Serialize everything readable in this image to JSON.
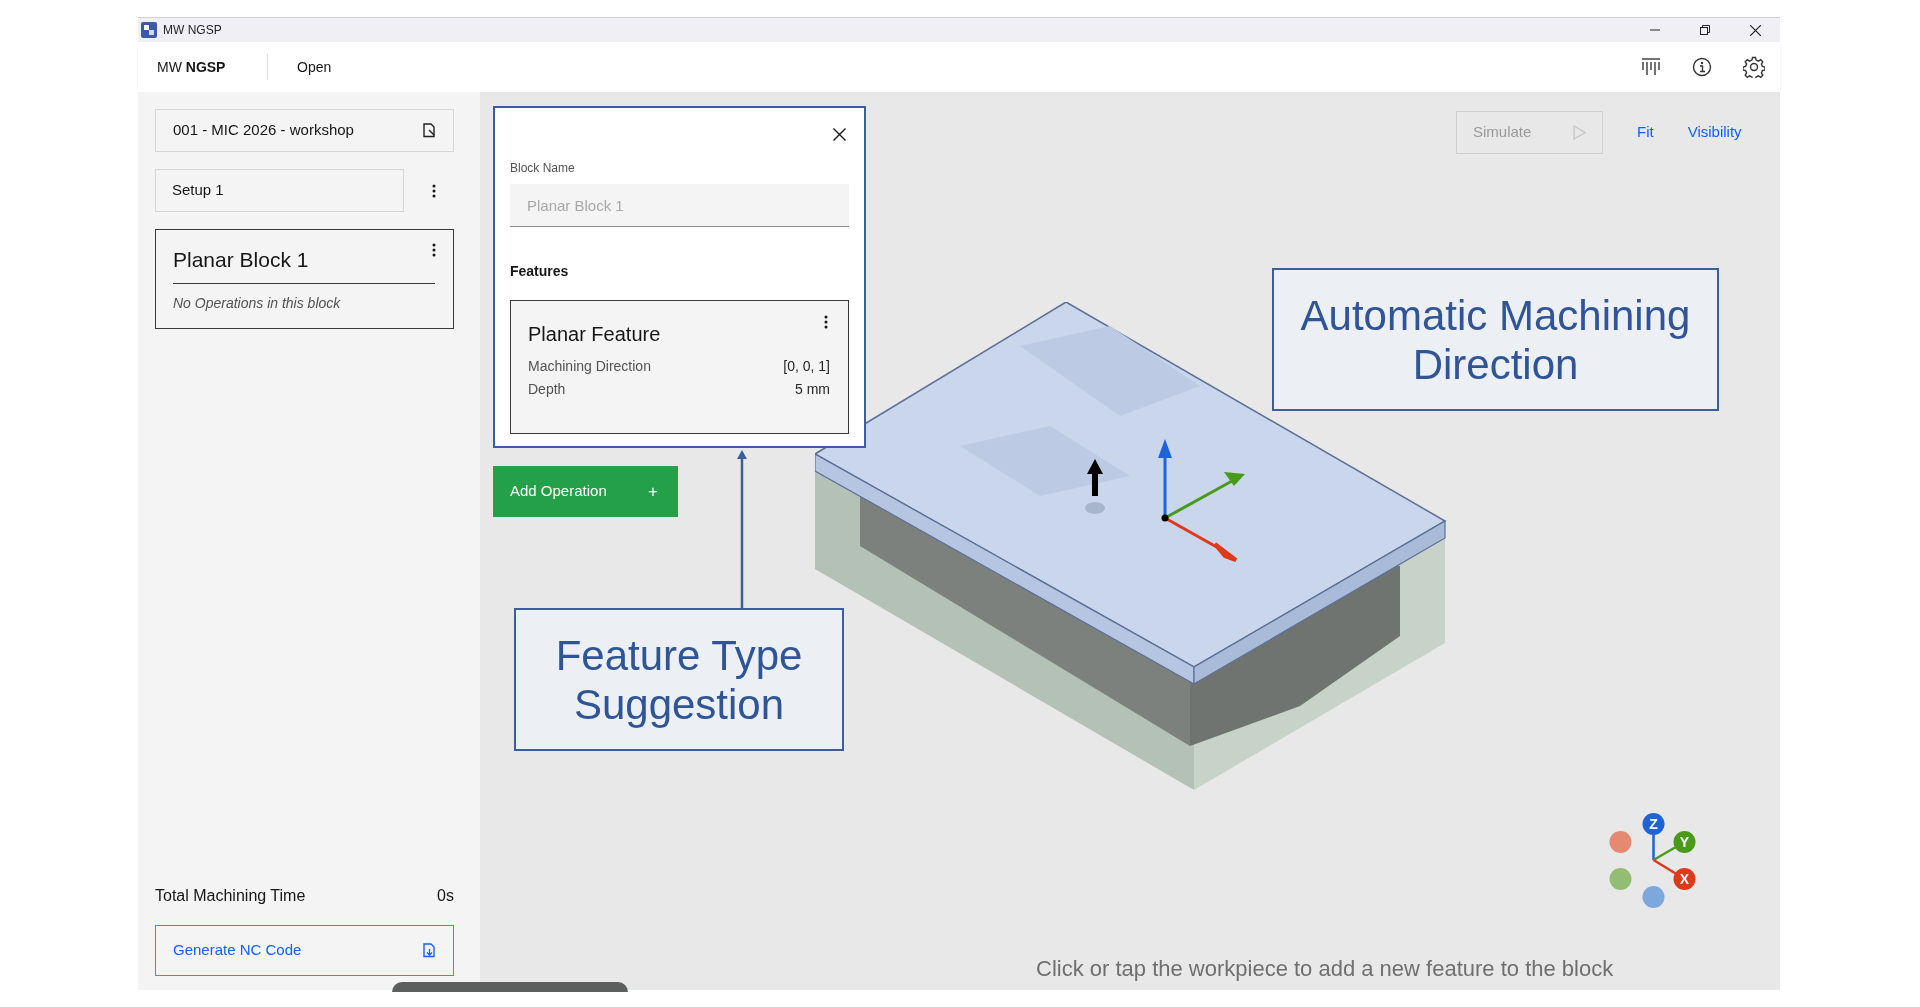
{
  "window": {
    "title": "MW NGSP"
  },
  "header": {
    "brand_prefix": "MW",
    "brand_name": "NGSP",
    "menu": [
      "Open"
    ]
  },
  "sidebar": {
    "project": "001 - MIC 2026 - workshop",
    "setup": "Setup 1",
    "blocks": [
      {
        "title": "Planar Block 1",
        "empty_text": "No Operations in this block",
        "selected": true
      }
    ],
    "total": {
      "label": "Total Machining Time",
      "value": "0s"
    },
    "generate_button": "Generate NC Code"
  },
  "dialog": {
    "block_name_label": "Block Name",
    "block_name_placeholder": "Planar Block 1",
    "features_heading": "Features",
    "features": [
      {
        "title": "Planar Feature",
        "rows": [
          {
            "label": "Machining Direction",
            "value": "[0, 0, 1]"
          },
          {
            "label": "Depth",
            "value": "5 mm"
          }
        ]
      }
    ],
    "add_button": {
      "label": "Add Operation",
      "icon": "+"
    }
  },
  "toolbar": {
    "simulate": {
      "label": "Simulate",
      "disabled": true
    },
    "links": [
      "Fit",
      "Visibility"
    ]
  },
  "annotations": [
    {
      "text": "Feature Type Suggestion"
    },
    {
      "text": "Automatic Machining Direction"
    }
  ],
  "gizmo": {
    "axes": [
      "Z",
      "Y",
      "X"
    ]
  },
  "hint": "Click or tap the workpiece to add a new feature to the block"
}
